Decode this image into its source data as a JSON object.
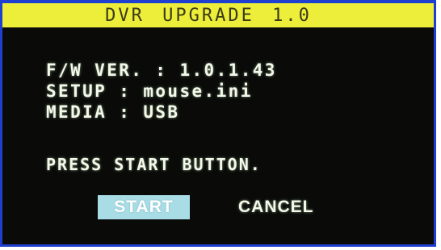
{
  "window": {
    "title": "DVR UPGRADE 1.0"
  },
  "info": {
    "fw_version": "F/W VER. : 1.0.1.43",
    "setup": "SETUP : mouse.ini",
    "media": "MEDIA : USB"
  },
  "prompt": "PRESS START BUTTON.",
  "buttons": {
    "start_label": "START",
    "cancel_label": "CANCEL"
  },
  "colors": {
    "frame_border": "#1f3fd0",
    "title_bar": "#ecee3a",
    "background": "#0a0b09",
    "text": "#f4f8ea",
    "start_highlight": "#a9dde6"
  }
}
